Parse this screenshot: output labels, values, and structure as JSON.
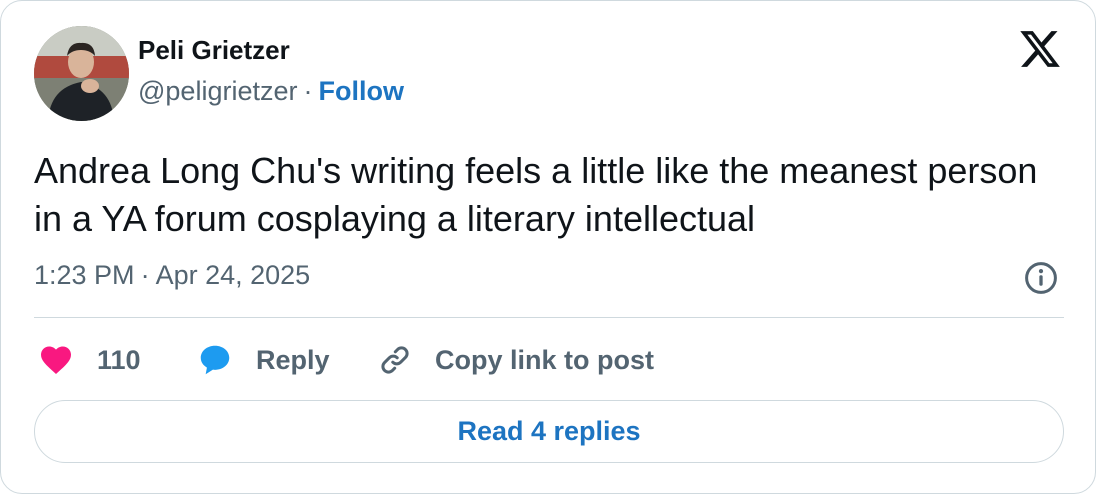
{
  "author": {
    "name": "Peli Grietzer",
    "handle": "@peligrietzer",
    "separator": "·",
    "follow_label": "Follow"
  },
  "tweet": {
    "text": "Andrea Long Chu's writing feels a little like the meanest person in a YA forum cosplaying a literary intellectual",
    "time": "1:23 PM",
    "date": "Apr 24, 2025"
  },
  "actions": {
    "like_count": "110",
    "reply_label": "Reply",
    "copy_label": "Copy link to post"
  },
  "footer": {
    "read_replies_label": "Read 4 replies"
  },
  "icons": {
    "brand": "x-logo-icon",
    "info": "info-icon",
    "like": "heart-icon",
    "reply": "speech-bubble-icon",
    "copy": "link-icon"
  },
  "colors": {
    "link": "#1d74c1",
    "secondary_text": "#536471",
    "heart": "#f91880",
    "reply_bubble": "#1d9bf0",
    "border": "#cfd9de"
  }
}
